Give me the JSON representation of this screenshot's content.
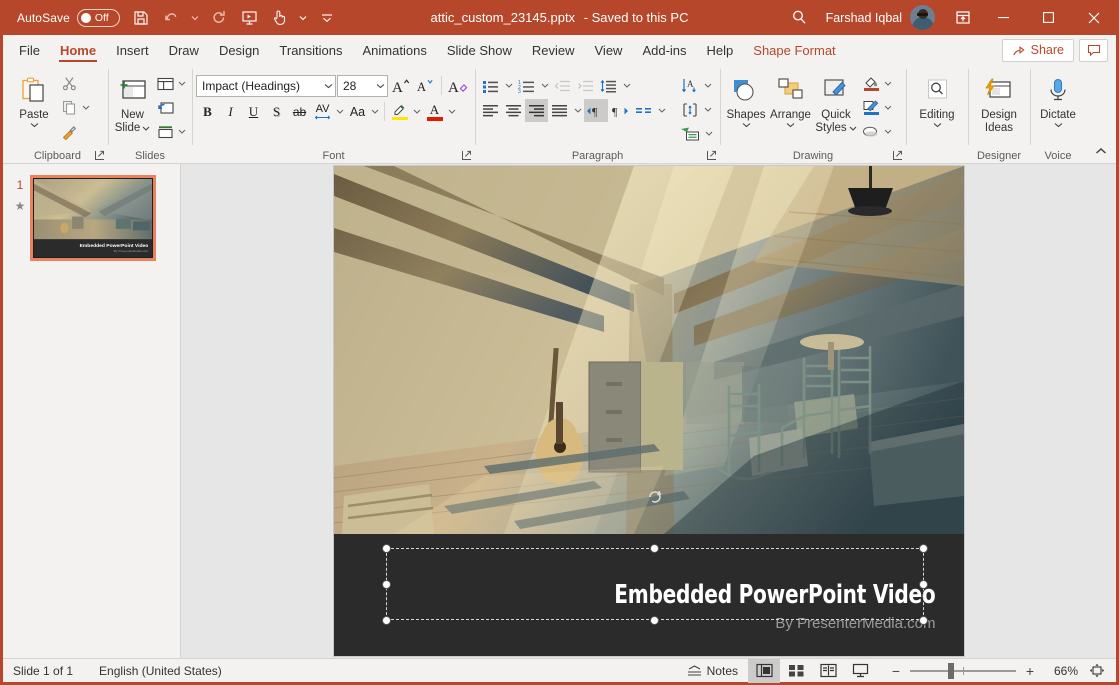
{
  "titlebar": {
    "autosave_label": "AutoSave",
    "autosave_state": "Off",
    "document_title": "attic_custom_23145.pptx",
    "save_state": "-  Saved to this PC",
    "account_name": "Farshad Iqbal",
    "icons": [
      "save-icon",
      "undo-icon",
      "redo-icon",
      "start-from-beginning-icon",
      "touch-mode-icon",
      "customize-qat-icon",
      "search-icon",
      "ribbon-display-options-icon",
      "minimize-icon",
      "maximize-icon",
      "close-icon"
    ]
  },
  "menubar": {
    "tabs": [
      {
        "label": "File",
        "active": false
      },
      {
        "label": "Home",
        "active": true
      },
      {
        "label": "Insert",
        "active": false
      },
      {
        "label": "Draw",
        "active": false
      },
      {
        "label": "Design",
        "active": false
      },
      {
        "label": "Transitions",
        "active": false
      },
      {
        "label": "Animations",
        "active": false
      },
      {
        "label": "Slide Show",
        "active": false
      },
      {
        "label": "Review",
        "active": false
      },
      {
        "label": "View",
        "active": false
      },
      {
        "label": "Add-ins",
        "active": false
      },
      {
        "label": "Help",
        "active": false
      }
    ],
    "contextual_tab": "Shape Format",
    "share_label": "Share",
    "comments_label": "Comments"
  },
  "ribbon": {
    "groups": [
      {
        "name": "Clipboard",
        "label": "Clipboard"
      },
      {
        "name": "Slides",
        "label": "Slides"
      },
      {
        "name": "Font",
        "label": "Font"
      },
      {
        "name": "Paragraph",
        "label": "Paragraph"
      },
      {
        "name": "Drawing",
        "label": "Drawing"
      },
      {
        "name": "Editing",
        "label": ""
      },
      {
        "name": "Designer",
        "label": "Designer"
      },
      {
        "name": "Voice",
        "label": "Voice"
      }
    ],
    "clipboard": {
      "paste_label": "Paste",
      "cut_label": "Cut",
      "copy_label": "Copy",
      "format_painter_label": "Format Painter"
    },
    "slides": {
      "new_slide_label": "New\nSlide",
      "new_slide_line1": "New",
      "new_slide_line2": "Slide",
      "layout_label": "Layout",
      "reset_label": "Reset",
      "section_label": "Section"
    },
    "font": {
      "font_name": "Impact (Headings)",
      "font_size": "28",
      "grow_label": "Increase Font Size",
      "shrink_label": "Decrease Font Size",
      "clear_label": "Clear All Formatting",
      "bold": "B",
      "italic": "I",
      "underline": "U",
      "shadow": "S",
      "strikethrough": "ab",
      "spacing": "AV",
      "change_case": "Aa",
      "highlight_label": "Text Highlight Color",
      "font_color_label": "Font Color"
    },
    "paragraph": {
      "bullets_label": "Bullets",
      "numbering_label": "Numbering",
      "decrease_indent_label": "Decrease List Level",
      "increase_indent_label": "Increase List Level",
      "line_spacing_label": "Line Spacing",
      "align_left_label": "Align Left",
      "center_label": "Center",
      "align_right_label": "Align Right",
      "justify_label": "Justify",
      "columns_label": "Columns",
      "ltr_label": "Left-to-Right Text Direction",
      "rtl_label": "Right-to-Left Text Direction",
      "text_direction_label": "Text Direction",
      "align_text_label": "Align Text",
      "smartart_label": "Convert to SmartArt"
    },
    "drawing": {
      "shapes_label": "Shapes",
      "arrange_label": "Arrange",
      "quick_styles_line1": "Quick",
      "quick_styles_line2": "Styles",
      "shape_fill_label": "Shape Fill",
      "shape_outline_label": "Shape Outline",
      "shape_effects_label": "Shape Effects"
    },
    "editing": {
      "label": "Editing"
    },
    "designer": {
      "line1": "Design",
      "line2": "Ideas"
    },
    "voice": {
      "label": "Dictate"
    },
    "collapse_label": "Collapse the Ribbon"
  },
  "thumbnail_pane": {
    "slide_number": "1",
    "animation_marker": "★"
  },
  "slide": {
    "caption_title": "Embedded PowerPoint Video",
    "caption_subtitle": "By PresenterMedia.com",
    "selection_active": true
  },
  "statusbar": {
    "slide_count": "Slide 1 of 1",
    "language": "English (United States)",
    "notes_label": "Notes",
    "views": [
      {
        "name": "normal-view",
        "selected": true
      },
      {
        "name": "slide-sorter-view",
        "selected": false
      },
      {
        "name": "reading-view",
        "selected": false
      },
      {
        "name": "slide-show-view",
        "selected": false
      }
    ],
    "zoom_out_label": "−",
    "zoom_in_label": "+",
    "zoom_level": "66%",
    "fit_label": "Fit slide to current window"
  },
  "colors": {
    "accent": "#b7472a",
    "ribbon_bg": "#f3f2f1",
    "workspace_bg": "#e6e6e6",
    "slide_band": "#2b2b2b",
    "selection_border": "#e8825f"
  }
}
